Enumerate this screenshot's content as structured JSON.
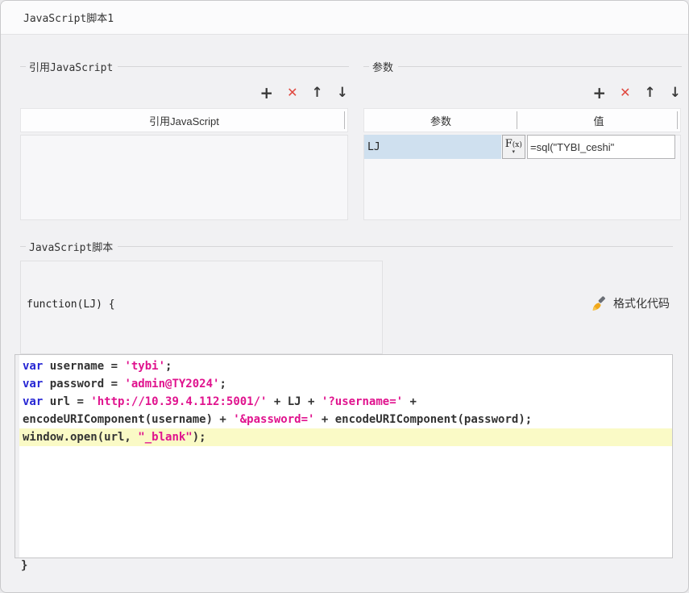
{
  "window": {
    "title": "JavaScript脚本1"
  },
  "toolbar_icons": {
    "add": "+",
    "delete": "✕",
    "move_up": "↑",
    "move_down": "↓"
  },
  "reference_section": {
    "label": "引用JavaScript",
    "table_header": "引用JavaScript"
  },
  "params_section": {
    "label": "参数",
    "col_param": "参数",
    "col_value": "值",
    "rows": [
      {
        "name": "LJ",
        "fx": "F",
        "fx_sub": "(x)",
        "caret": "▾",
        "value": "=sql(\"TYBI_ceshi\""
      }
    ]
  },
  "script_section": {
    "label": "JavaScript脚本",
    "function_header": "function(LJ) {",
    "format_button_label": "格式化代码",
    "closing_brace": "}"
  },
  "editor": {
    "lines": [
      {
        "hl": false,
        "tokens": [
          [
            "k",
            "var"
          ],
          [
            "p",
            " username = "
          ],
          [
            "s",
            "'tybi'"
          ],
          [
            "p",
            ";"
          ]
        ]
      },
      {
        "hl": false,
        "tokens": [
          [
            "k",
            "var"
          ],
          [
            "p",
            " password = "
          ],
          [
            "s",
            "'admin@TY2024'"
          ],
          [
            "p",
            ";"
          ]
        ]
      },
      {
        "hl": false,
        "tokens": [
          [
            "k",
            "var"
          ],
          [
            "p",
            " url = "
          ],
          [
            "s",
            "'http://10.39.4.112:5001/'"
          ],
          [
            "p",
            " + LJ + "
          ],
          [
            "s",
            "'?username='"
          ],
          [
            "p",
            " +"
          ]
        ]
      },
      {
        "hl": false,
        "tokens": [
          [
            "p",
            "encodeURIComponent(username) + "
          ],
          [
            "s",
            "'&password='"
          ],
          [
            "p",
            " + encodeURIComponent(password);"
          ]
        ]
      },
      {
        "hl": true,
        "tokens": [
          [
            "p",
            "window.open(url, "
          ],
          [
            "s",
            "\"_blank\""
          ],
          [
            "p",
            ");"
          ]
        ]
      }
    ]
  },
  "colors": {
    "selection_blue": "#cfe0ef",
    "line_highlight": "#fafac6",
    "keyword_blue": "#2727d4",
    "string_magenta": "#e0138e",
    "delete_red": "#e0483f",
    "brush_gold": "#f0a81c"
  }
}
